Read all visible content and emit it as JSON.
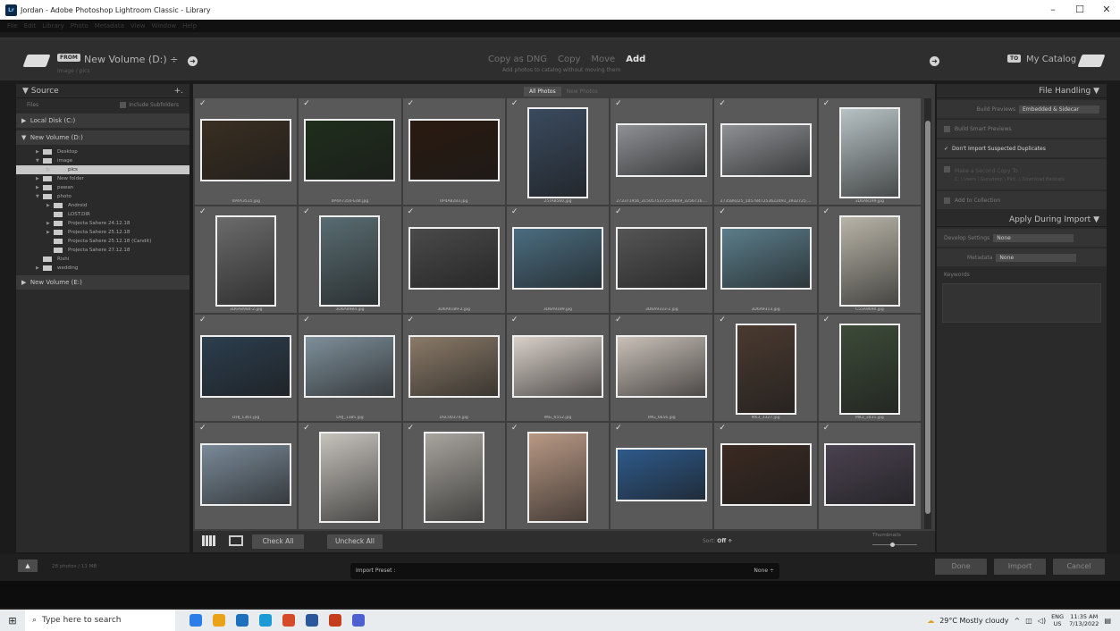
{
  "title": "Jordan - Adobe Photoshop Lightroom Classic - Library",
  "window_controls": [
    "–",
    "☐",
    "✕"
  ],
  "menu": [
    "File",
    "Edit",
    "Library",
    "Photo",
    "Metadata",
    "View",
    "Window",
    "Help"
  ],
  "header": {
    "from_badge": "FROM",
    "from_volume": "New Volume (D:) ÷",
    "from_path": "Image / pics",
    "modes": [
      "Copy as DNG",
      "Copy",
      "Move",
      "Add"
    ],
    "active_mode": "Add",
    "mode_description": "Add photos to catalog without moving them",
    "to_badge": "TO",
    "to_catalog": "My Catalog"
  },
  "source": {
    "title": "Source",
    "plus": "+.",
    "files_label": "Files",
    "include_subfolders": "Include Subfolders",
    "drives": [
      "Local Disk (C:)",
      "New Volume (D:)",
      "New Volume (E:)"
    ],
    "folders": [
      {
        "name": "Desktop",
        "tri": "▶",
        "indent": 1
      },
      {
        "name": "image",
        "tri": "▼",
        "indent": 1
      },
      {
        "name": "pics",
        "tri": "▷",
        "indent": 2,
        "selected": true
      },
      {
        "name": "New folder",
        "tri": "▶",
        "indent": 1
      },
      {
        "name": "pawan",
        "tri": "▶",
        "indent": 1
      },
      {
        "name": "photo",
        "tri": "▼",
        "indent": 1
      },
      {
        "name": "Android",
        "tri": "▶",
        "indent": 2
      },
      {
        "name": "LOST.DIR",
        "tri": "",
        "indent": 2
      },
      {
        "name": "Projecta Sahere 24.12.18",
        "tri": "▶",
        "indent": 2
      },
      {
        "name": "Projecta Sahere 25.12.18",
        "tri": "▶",
        "indent": 2
      },
      {
        "name": "Projecta Sahere 25.12.18 (Candit)",
        "tri": "",
        "indent": 2
      },
      {
        "name": "Projecta Sahere 27.12.18",
        "tri": "",
        "indent": 2
      },
      {
        "name": "Rishi",
        "tri": "",
        "indent": 1
      },
      {
        "name": "wedding",
        "tri": "▶",
        "indent": 1
      }
    ]
  },
  "grid": {
    "tabs": [
      "All Photos",
      "New Photos"
    ],
    "checkmark": "✓",
    "photos": [
      {
        "name": "0P4A3515.jpg",
        "color": "#3a2f22",
        "w": 102,
        "h": 70
      },
      {
        "name": "0P4A7350-Edit.jpg",
        "color": "#1f2e1c",
        "w": 102,
        "h": 70
      },
      {
        "name": "0P4A8283.jpg",
        "color": "#2a1a10",
        "w": 102,
        "h": 70
      },
      {
        "name": "25TA8560.jpg",
        "color": "#3a4a5e",
        "w": 68,
        "h": 102
      },
      {
        "name": "273371956_3150575372559669_3256716....",
        "color": "#8e9094",
        "w": 102,
        "h": 60
      },
      {
        "name": "273589225_1057847253622491_3932725....",
        "color": "#8e9094",
        "w": 102,
        "h": 60
      },
      {
        "name": "3D6A8199.jpg",
        "color": "#b7c2c4",
        "w": 68,
        "h": 102
      },
      {
        "name": "3D6A8984-2.jpg",
        "color": "#6b6b6b",
        "w": 68,
        "h": 102
      },
      {
        "name": "3D6A8984.jpg",
        "color": "#596c72",
        "w": 68,
        "h": 102
      },
      {
        "name": "3D6A9189-2.jpg",
        "color": "#4a4a4a",
        "w": 102,
        "h": 70
      },
      {
        "name": "3D6A9189.jpg",
        "color": "#4b6d80",
        "w": 102,
        "h": 70
      },
      {
        "name": "3D6A9333-2.jpg",
        "color": "#555555",
        "w": 102,
        "h": 70
      },
      {
        "name": "3D6A9313.jpg",
        "color": "#5b7d8a",
        "w": 102,
        "h": 70
      },
      {
        "name": "C55A9690.jpg",
        "color": "#b8b4a8",
        "w": 68,
        "h": 102
      },
      {
        "name": "DHJ_1361.jpg",
        "color": "#2c3e4e",
        "w": 102,
        "h": 70
      },
      {
        "name": "DHJ_1385.jpg",
        "color": "#7e8f9a",
        "w": 102,
        "h": 70
      },
      {
        "name": "DSC00374.jpg",
        "color": "#8a7a68",
        "w": 102,
        "h": 70
      },
      {
        "name": "IMG_6552.jpg",
        "color": "#d8cfc8",
        "w": 102,
        "h": 70
      },
      {
        "name": "IMG_6656.jpg",
        "color": "#c9c0b8",
        "w": 102,
        "h": 70
      },
      {
        "name": "MK3_3327.jpg",
        "color": "#4a3a30",
        "w": 68,
        "h": 102
      },
      {
        "name": "MK3_3431.jpg",
        "color": "#3c4a38",
        "w": 68,
        "h": 102
      },
      {
        "name": "",
        "color": "#7a8a98",
        "w": 102,
        "h": 70
      },
      {
        "name": "",
        "color": "#c6c2bc",
        "w": 68,
        "h": 102
      },
      {
        "name": "",
        "color": "#a8a49e",
        "w": 68,
        "h": 102
      },
      {
        "name": "",
        "color": "#b89884",
        "w": 68,
        "h": 102
      },
      {
        "name": "",
        "color": "#2e5a8a",
        "w": 102,
        "h": 60
      },
      {
        "name": "",
        "color": "#3a2a22",
        "w": 102,
        "h": 70
      },
      {
        "name": "",
        "color": "#4a4250",
        "w": 102,
        "h": 70
      }
    ],
    "check_all": "Check All",
    "uncheck_all": "Uncheck All",
    "sort_label": "Sort:",
    "sort_value": "Off ÷",
    "thumbnails_label": "Thumbnails",
    "thumbnail_size_fraction": 0.4
  },
  "right": {
    "file_handling_title": "File Handling",
    "build_previews_label": "Build Previews",
    "build_previews_value": "Embedded & Sidecar",
    "build_smart_previews": "Build Smart Previews",
    "dont_import_duplicates": "Don't Import Suspected Duplicates",
    "second_copy": "Make a Second Copy To :",
    "second_copy_path": "C: \\ Users \\ Gurudeep \\ Pict...\\ Download Backups",
    "add_to_collection": "Add to Collection",
    "apply_title": "Apply During Import",
    "develop_label": "Develop Settings",
    "develop_value": "None",
    "metadata_label": "Metadata",
    "metadata_value": "None",
    "keywords_label": "Keywords"
  },
  "bottom": {
    "up_arrow": "▲",
    "photo_count": "28 photos / 11 MB",
    "preset_label": "Import Preset :",
    "preset_value": "None ÷",
    "done": "Done",
    "import": "Import",
    "cancel": "Cancel"
  },
  "taskbar": {
    "start": "⊞",
    "search_placeholder": "Type here to search",
    "weather": "29°C  Mostly cloudy",
    "lang": "ENG",
    "region": "US",
    "time": "11:35 AM",
    "date": "7/13/2022",
    "app_colors": [
      "#2b7de9",
      "#e8a317",
      "#1f6fbf",
      "#1b9ad6",
      "#d54a28",
      "#2b579a",
      "#c43e1c",
      "#4d5fd1"
    ]
  }
}
